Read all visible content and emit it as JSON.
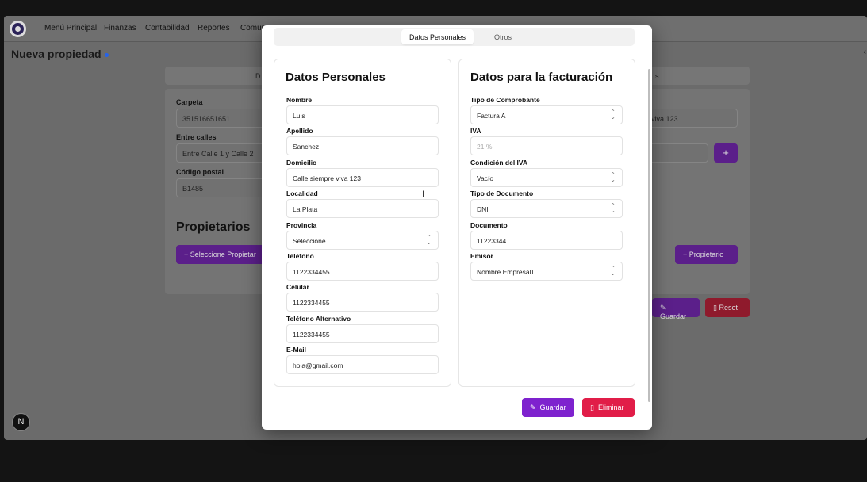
{
  "nav": {
    "items": [
      "Menú Principal",
      "Finanzas",
      "Contabilidad",
      "Reportes",
      "Comun"
    ]
  },
  "page": {
    "title": "Nueva propiedad"
  },
  "background": {
    "tab_left": "D",
    "tab_right": "s",
    "carpeta_label": "Carpeta",
    "carpeta_value": "351516651651",
    "entre_calles_label": "Entre calles",
    "entre_calles_value": "Entre Calle 1 y Calle 2",
    "codigo_postal_label": "Código postal",
    "codigo_postal_value": "B1485",
    "right_input_value": "viva 123",
    "propietarios_heading": "Propietarios",
    "seleccione_propietario": "Seleccione Propietar",
    "add_propietario": "Propietario",
    "guardar": "Guardar",
    "reset": "Reset",
    "next_badge": "N"
  },
  "modal": {
    "tabs": [
      {
        "label": "Datos Personales",
        "active": true
      },
      {
        "label": "Otros",
        "active": false
      }
    ],
    "personal": {
      "title": "Datos Personales",
      "fields": [
        {
          "label": "Nombre",
          "value": "Luis"
        },
        {
          "label": "Apellido",
          "value": "Sanchez"
        },
        {
          "label": "Domicilio",
          "value": "Calle siempre viva 123"
        },
        {
          "label": "Localidad",
          "value": "La Plata"
        },
        {
          "label": "Provincia",
          "value": "Seleccione..."
        },
        {
          "label": "Teléfono",
          "value": "1122334455"
        },
        {
          "label": "Celular",
          "value": "1122334455"
        },
        {
          "label": "Teléfono Alternativo",
          "value": "1122334455"
        },
        {
          "label": "E-Mail",
          "value": "hola@gmail.com"
        }
      ]
    },
    "billing": {
      "title": "Datos para la facturación",
      "fields": [
        {
          "label": "Tipo de Comprobante",
          "value": "Factura A"
        },
        {
          "label": "IVA",
          "value": "21 %"
        },
        {
          "label": "Condición del IVA",
          "value": "Vacío"
        },
        {
          "label": "Tipo de Documento",
          "value": "DNI"
        },
        {
          "label": "Documento",
          "value": "11223344"
        },
        {
          "label": "Emisor",
          "value": "Nombre Empresa0"
        }
      ]
    },
    "buttons": {
      "save": "Guardar",
      "delete": "Eliminar"
    }
  },
  "colors": {
    "primary": "#7e22ce",
    "danger": "#e11d48",
    "info_dot": "#2563eb"
  },
  "icons": {
    "save": "edit-icon",
    "delete": "trash-icon",
    "select": "chevron-up-down-icon",
    "add": "plus-icon"
  }
}
